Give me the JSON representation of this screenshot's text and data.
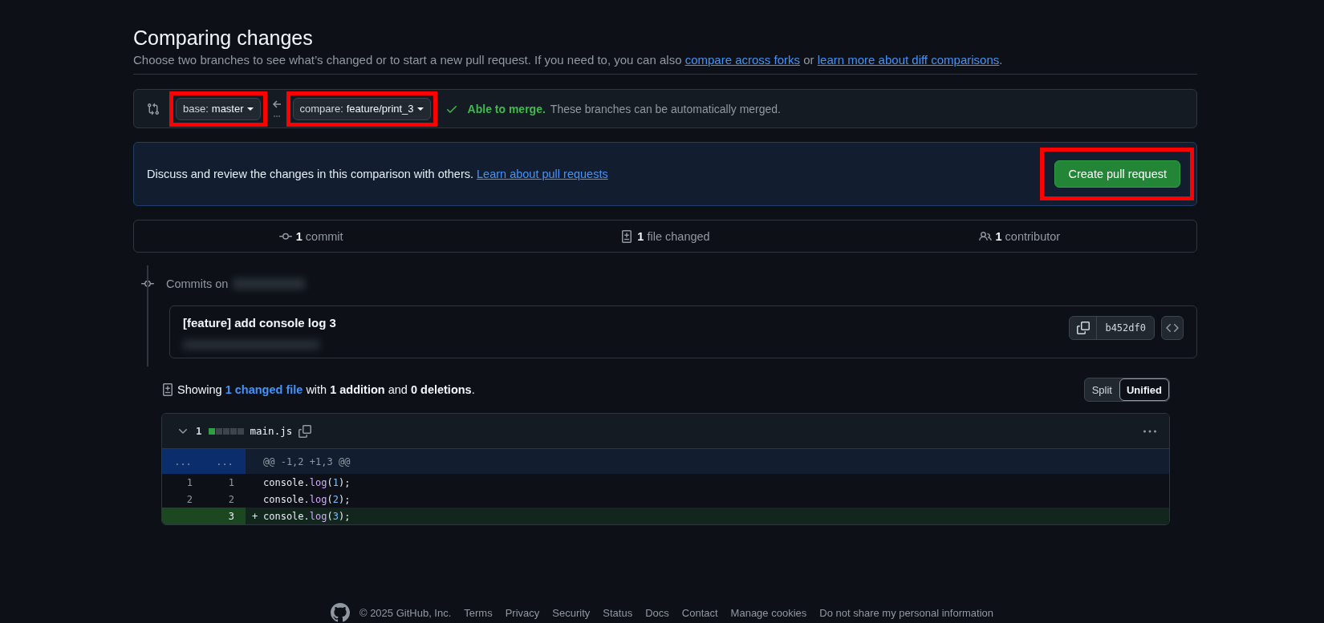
{
  "header": {
    "title": "Comparing changes",
    "description": [
      {
        "kind": "text",
        "text": "Choose two branches to see what’s changed or to start a new pull request. If you need to, you can also "
      },
      {
        "kind": "link",
        "text": "compare across forks"
      },
      {
        "kind": "text",
        "text": " or "
      },
      {
        "kind": "link",
        "text": "learn more about diff comparisons"
      },
      {
        "kind": "text",
        "text": "."
      }
    ]
  },
  "branch_bar": {
    "base": {
      "prefix": "base:",
      "value": "master",
      "highlighted": true
    },
    "compare": {
      "prefix": "compare:",
      "value": "feature/print_3",
      "highlighted": true
    },
    "merge_status": {
      "kind": "mergeable",
      "title": "Able to merge.",
      "text": "These branches can be automatically merged."
    }
  },
  "banner": {
    "text": "Discuss and review the changes in this comparison with others. ",
    "link": "Learn about pull requests",
    "button": {
      "label": "Create pull request",
      "highlighted": true
    }
  },
  "stats": [
    {
      "kind": "commit",
      "count": "1",
      "label": "commit"
    },
    {
      "kind": "file",
      "count": "1",
      "label": "file changed"
    },
    {
      "kind": "people",
      "count": "1",
      "label": "contributor"
    }
  ],
  "commits": {
    "heading": "Commits on",
    "items": [
      {
        "title": "[feature] add console log 3",
        "sha": "b452df0"
      }
    ]
  },
  "diff": {
    "summary": {
      "before": "Showing ",
      "link": "1 changed file",
      "after": " with **1 addition** and **0 deletions**."
    },
    "view_modes": [
      {
        "label": "Split",
        "selected": false
      },
      {
        "label": "Unified",
        "selected": true
      }
    ],
    "files": [
      {
        "expanded": true,
        "changes": "1",
        "diffstat": [
          {
            "kind": "added"
          },
          {
            "kind": "neutral"
          },
          {
            "kind": "neutral"
          },
          {
            "kind": "neutral"
          },
          {
            "kind": "neutral"
          }
        ],
        "name": "main.js",
        "hunk": {
          "old": "...",
          "new": "...",
          "header": "@@ -1,2 +1,3 @@"
        },
        "lines": [
          {
            "kind": "context",
            "old": "1",
            "new": "1",
            "code": [
              {
                "kind": "plain",
                "text": "console."
              },
              {
                "kind": "function",
                "text": "log"
              },
              {
                "kind": "plain",
                "text": "("
              },
              {
                "kind": "number",
                "text": "1"
              },
              {
                "kind": "plain",
                "text": ");"
              }
            ]
          },
          {
            "kind": "context",
            "old": "2",
            "new": "2",
            "code": [
              {
                "kind": "plain",
                "text": "console."
              },
              {
                "kind": "function",
                "text": "log"
              },
              {
                "kind": "plain",
                "text": "("
              },
              {
                "kind": "number",
                "text": "2"
              },
              {
                "kind": "plain",
                "text": ");"
              }
            ]
          },
          {
            "kind": "addition",
            "new": "3",
            "marker": "+",
            "code": [
              {
                "kind": "plain",
                "text": "console."
              },
              {
                "kind": "function",
                "text": "log"
              },
              {
                "kind": "plain",
                "text": "("
              },
              {
                "kind": "number",
                "text": "3"
              },
              {
                "kind": "plain",
                "text": ");"
              }
            ]
          }
        ]
      }
    ]
  },
  "footer": {
    "copyright": "© 2025 GitHub, Inc.",
    "links": [
      "Terms",
      "Privacy",
      "Security",
      "Status",
      "Docs",
      "Contact",
      "Manage cookies",
      "Do not share my personal information"
    ]
  }
}
